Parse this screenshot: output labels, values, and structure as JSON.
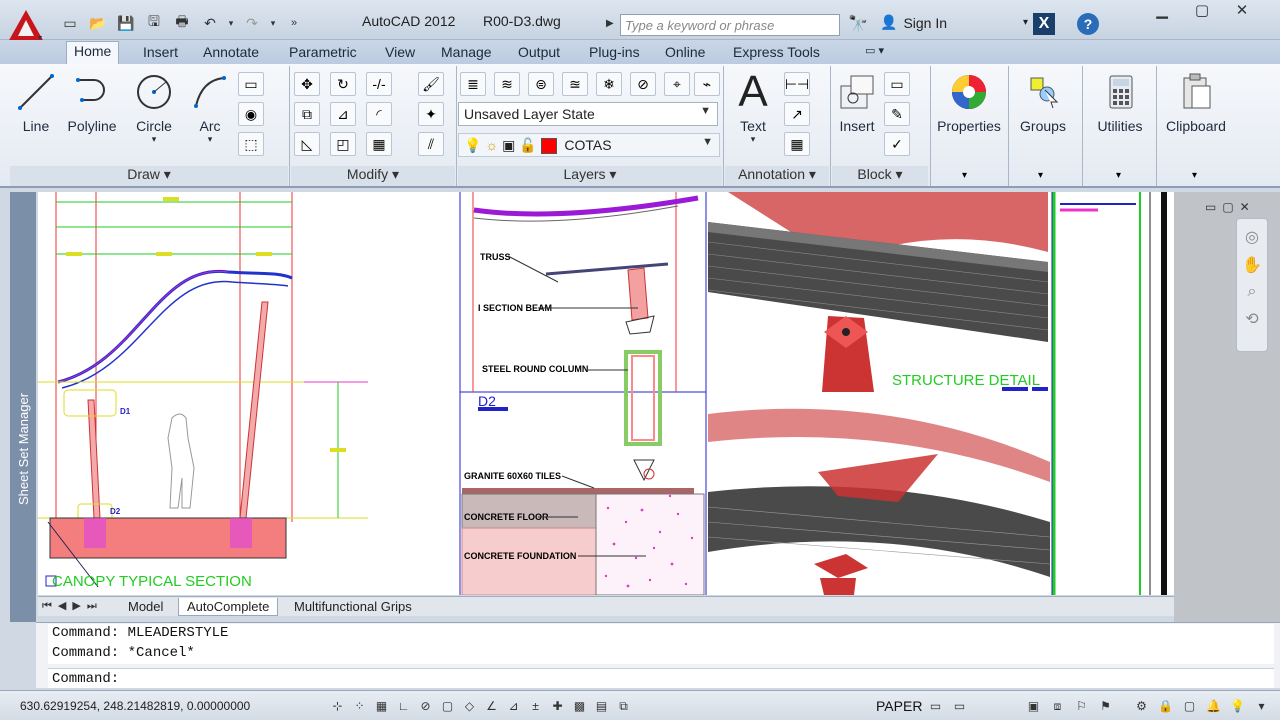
{
  "window": {
    "app_title": "AutoCAD 2012",
    "file_name": "R00-D3.dwg",
    "search_placeholder": "Type a keyword or phrase",
    "sign_in": "Sign In"
  },
  "ribbon_tabs": [
    "Home",
    "Insert",
    "Annotate",
    "Parametric",
    "View",
    "Manage",
    "Output",
    "Plug-ins",
    "Online",
    "Express Tools"
  ],
  "ribbon": {
    "draw": {
      "title": "Draw",
      "line": "Line",
      "polyline": "Polyline",
      "circle": "Circle",
      "arc": "Arc"
    },
    "modify": {
      "title": "Modify"
    },
    "layers": {
      "title": "Layers",
      "layer_state": "Unsaved Layer State",
      "current_layer": "COTAS",
      "layer_color": "#ff0000"
    },
    "annotation": {
      "title": "Annotation",
      "text": "Text"
    },
    "block": {
      "title": "Block",
      "insert": "Insert"
    },
    "properties": "Properties",
    "groups": "Groups",
    "utilities": "Utilities",
    "clipboard": "Clipboard"
  },
  "side_panel": {
    "label": "Sheet Set Manager"
  },
  "drawing": {
    "labels": {
      "canopy": "CANOPY TYPICAL SECTION",
      "structure": "STRUCTURE DETAIL",
      "d1": "D1",
      "d2": "D2",
      "d2_title": "D2",
      "truss": "TRUSS",
      "i_beam": "I SECTION BEAM",
      "column": "STEEL ROUND COLUMN",
      "granite": "GRANITE 60X60 TILES",
      "concrete_floor": "CONCRETE FLOOR",
      "concrete_foundation": "CONCRETE FOUNDATION"
    }
  },
  "layout_tabs": [
    "Model",
    "AutoComplete",
    "Multifunctional Grips"
  ],
  "command_line": {
    "history": [
      "Command: MLEADERSTYLE",
      "Command: *Cancel*"
    ],
    "prompt": "Command:"
  },
  "status_bar": {
    "coords": "630.62919254, 248.21482819, 0.00000000",
    "space": "PAPER"
  }
}
